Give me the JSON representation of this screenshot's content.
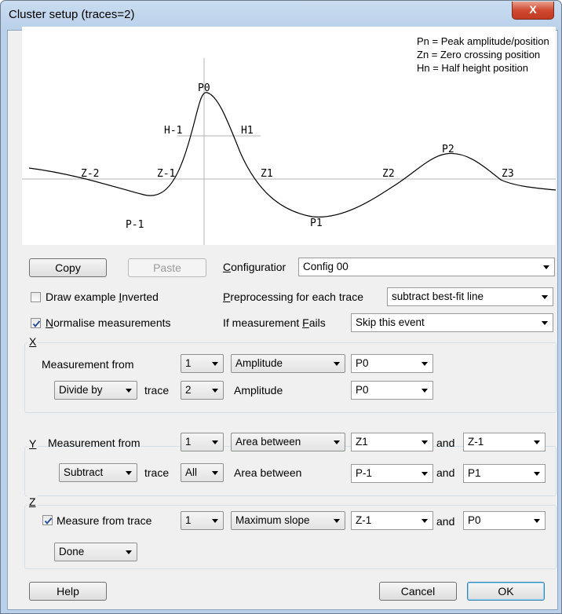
{
  "window": {
    "title": "Cluster setup (traces=2)",
    "close_label": "X"
  },
  "preview": {
    "legend": [
      "Pn = Peak amplitude/position",
      "Zn = Zero crossing position",
      "Hn = Half height position"
    ],
    "labels": {
      "p0": "P0",
      "p1": "P1",
      "p2": "P2",
      "pm1": "P-1",
      "hm1": "H-1",
      "h1": "H1",
      "zm2": "Z-2",
      "zm1": "Z-1",
      "z1": "Z1",
      "z2": "Z2",
      "z3": "Z3"
    }
  },
  "toolbar": {
    "copy": "Copy",
    "paste": "Paste"
  },
  "configuration": {
    "label_u": "C",
    "label_rest": "onfiguratior",
    "value": "Config 00"
  },
  "draw_inverted": {
    "label_pre": "Draw example ",
    "label_u": "I",
    "label_post": "nverted",
    "checked": false
  },
  "preprocessing": {
    "label_u": "P",
    "label_rest": "reprocessing for each trace",
    "value": "subtract best-fit line"
  },
  "normalise": {
    "label_u": "N",
    "label_rest": "ormalise measurements",
    "checked": true
  },
  "if_fails": {
    "label_pre": "If measurement ",
    "label_u": "F",
    "label_post": "ails",
    "value": "Skip this event"
  },
  "x": {
    "group_label": "X",
    "measurement_from": "Measurement from",
    "trace": "1",
    "measure": "Amplitude",
    "point": "P0",
    "op": "Divide by",
    "trace_word": "trace",
    "trace2": "2",
    "measure2": "Amplitude",
    "point2": "P0"
  },
  "y": {
    "group_label": "Y",
    "measurement_from": "Measurement from",
    "trace": "1",
    "measure": "Area between",
    "point": "Z1",
    "and": "and",
    "point_b": "Z-1",
    "op": "Subtract",
    "trace_word": "trace",
    "trace2": "All",
    "measure2": "Area between",
    "point2": "P-1",
    "and2": "and",
    "point2_b": "P1"
  },
  "z": {
    "group_label": "Z",
    "measure_from_trace": "Measure from trace",
    "checked": true,
    "trace": "1",
    "measure": "Maximum slope",
    "point": "Z-1",
    "and": "and",
    "point_b": "P0",
    "op": "Done"
  },
  "footer": {
    "help": "Help",
    "cancel": "Cancel",
    "ok": "OK"
  }
}
